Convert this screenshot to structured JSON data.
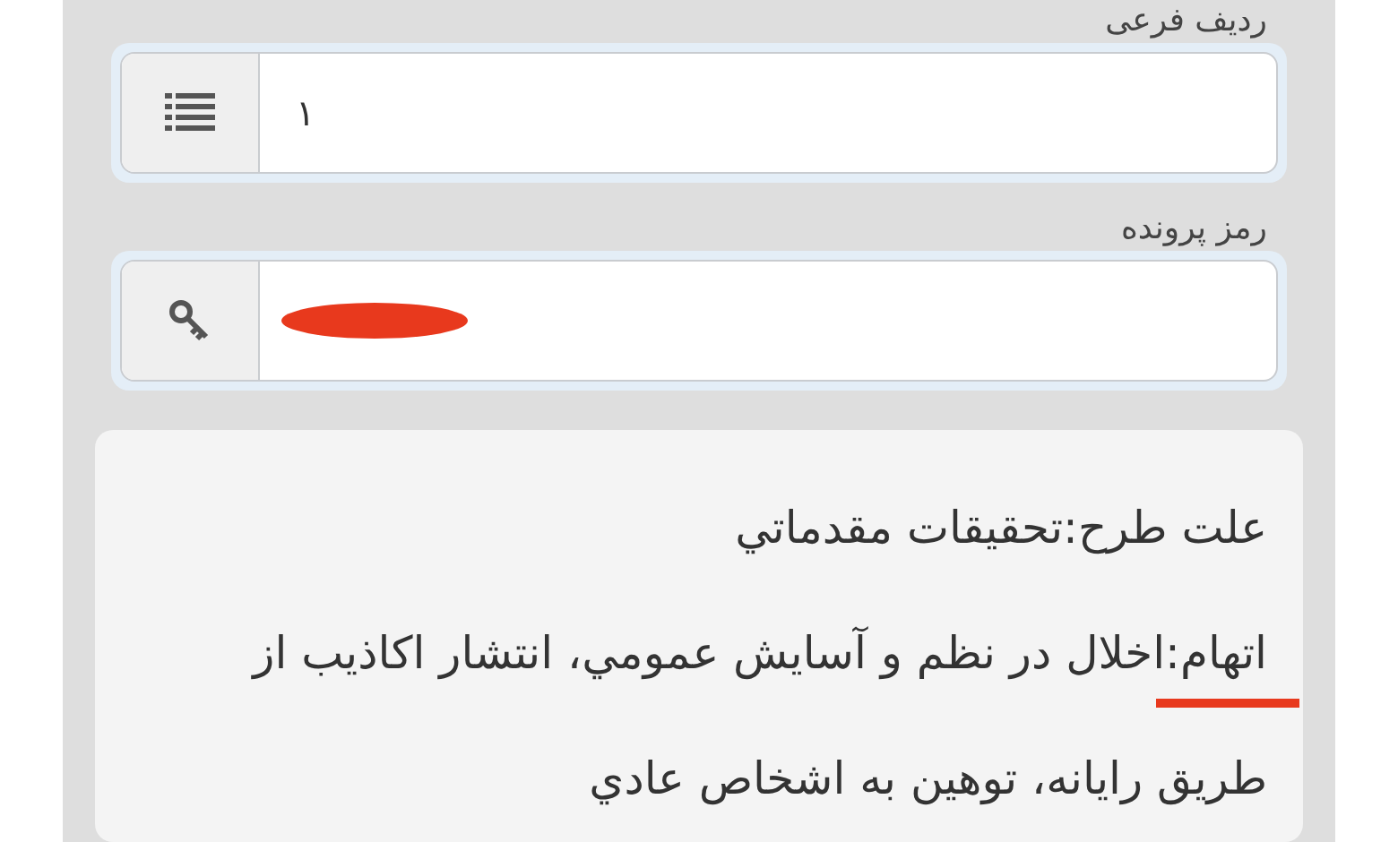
{
  "fields": [
    {
      "label": "ردیف فرعی",
      "value": "۱",
      "kind": "list"
    },
    {
      "label": "رمز پرونده",
      "kind": "key",
      "redacted": true
    }
  ],
  "details": [
    {
      "text": "علت طرح:تحقيقات مقدماتي",
      "underlined": false
    },
    {
      "text": "اتهام:اخلال در نظم و آسايش عمومي، انتشار اكاذيب از طريق رايانه، توهين به اشخاص عادي",
      "underlined": true
    }
  ]
}
